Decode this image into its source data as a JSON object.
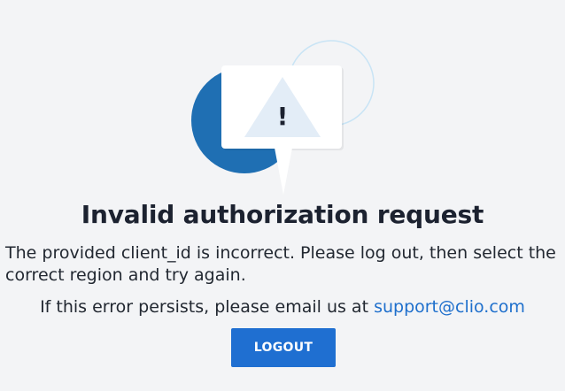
{
  "illustration": {
    "icon": "warning-icon",
    "exclamation": "!",
    "colors": {
      "circle": "#1f6fb3",
      "outline_circle": "#c9e4f5",
      "card": "#ffffff",
      "triangle": "#e3edf7",
      "mark": "#1c2230"
    }
  },
  "error": {
    "title": "Invalid authorization request",
    "message": "The provided client_id is incorrect. Please log out, then select the correct region and try again."
  },
  "help": {
    "prefix": "If this error persists, please email us at ",
    "email": "support@clio.com"
  },
  "actions": {
    "logout_label": "LOGOUT"
  },
  "colors": {
    "background": "#f3f4f6",
    "accent": "#1f6fd1",
    "link": "#1e6fcc"
  }
}
